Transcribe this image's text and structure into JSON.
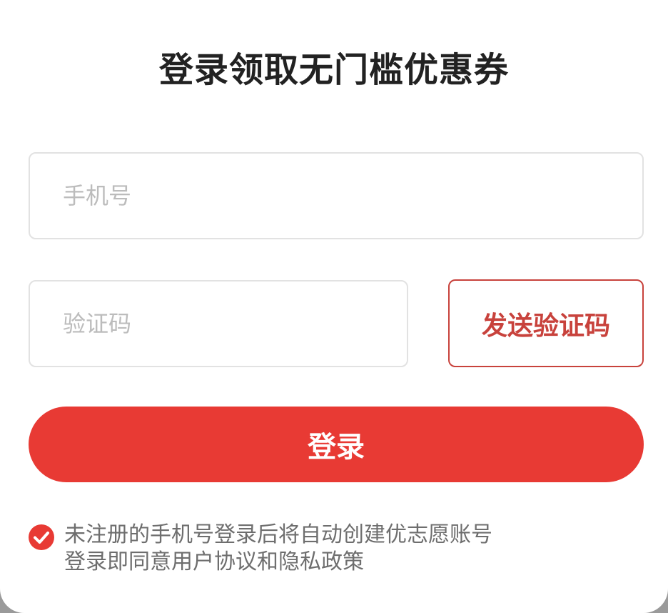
{
  "title": "登录领取无门槛优惠券",
  "phone_field": {
    "placeholder": "手机号",
    "value": ""
  },
  "code_field": {
    "placeholder": "验证码",
    "value": ""
  },
  "send_code_label": "发送验证码",
  "login_label": "登录",
  "agreement": {
    "checked": true,
    "line1": "未注册的手机号登录后将自动创建优志愿账号",
    "line2": "登录即同意用户协议和隐私政策"
  },
  "colors": {
    "accent": "#e83a34",
    "send_code": "#c8423c",
    "title": "#222222",
    "placeholder": "#bcbcbc",
    "hint_text": "#6e6e6e",
    "field_border": "#e2e2e2"
  }
}
